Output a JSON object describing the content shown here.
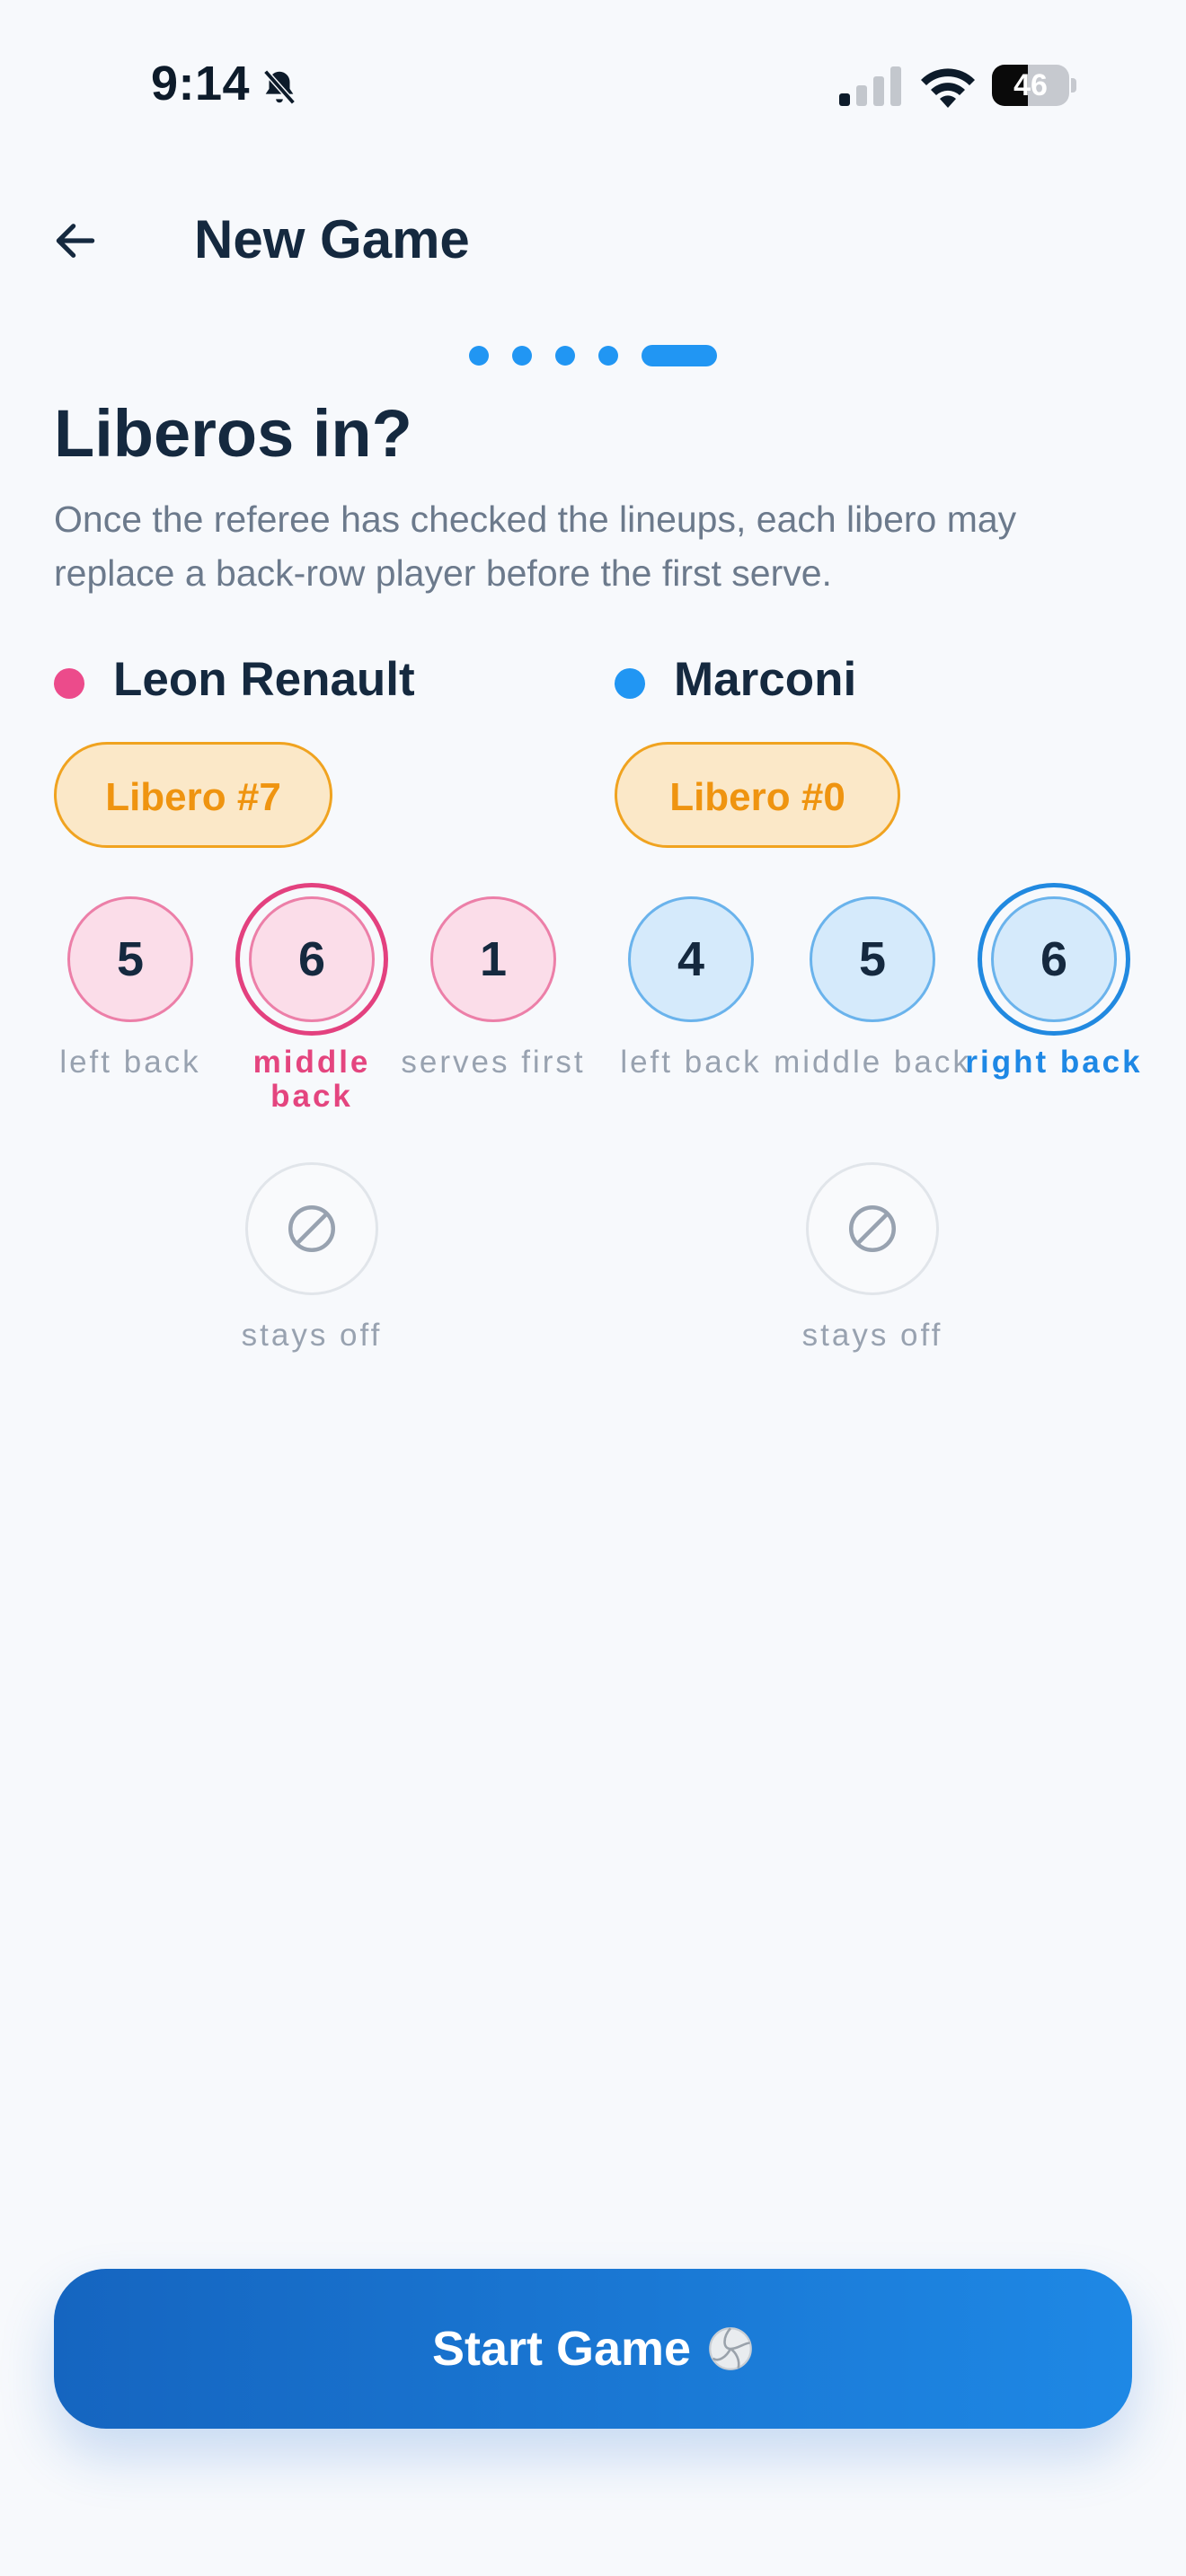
{
  "status_bar": {
    "time": "9:14",
    "battery_level": "46",
    "battery_fraction": 0.46
  },
  "header": {
    "title": "New Game",
    "steps_total": 5,
    "current_step": 5
  },
  "heading": "Liberos in?",
  "description": "Once the referee has checked the lineups, each libero may replace a back-row player before the first serve.",
  "teams": [
    {
      "name": "Leon Renault",
      "color": "#ec4b8b",
      "libero_label": "Libero #7",
      "players": [
        {
          "number": "5",
          "label": "left back",
          "selected": false
        },
        {
          "number": "6",
          "label": "middle back",
          "selected": true
        },
        {
          "number": "1",
          "label": "serves first",
          "selected": false
        }
      ],
      "stays_off_label": "stays off"
    },
    {
      "name": "Marconi",
      "color": "#2196f3",
      "libero_label": "Libero #0",
      "players": [
        {
          "number": "4",
          "label": "left back",
          "selected": false
        },
        {
          "number": "5",
          "label": "middle back",
          "selected": false
        },
        {
          "number": "6",
          "label": "right back",
          "selected": true
        }
      ],
      "stays_off_label": "stays off"
    }
  ],
  "start_button": {
    "label": "Start Game"
  },
  "icons": {
    "bell": "bell-slash-icon",
    "back": "arrow-left-icon",
    "ball": "volleyball-icon",
    "stays_off": "prohibited-icon"
  }
}
